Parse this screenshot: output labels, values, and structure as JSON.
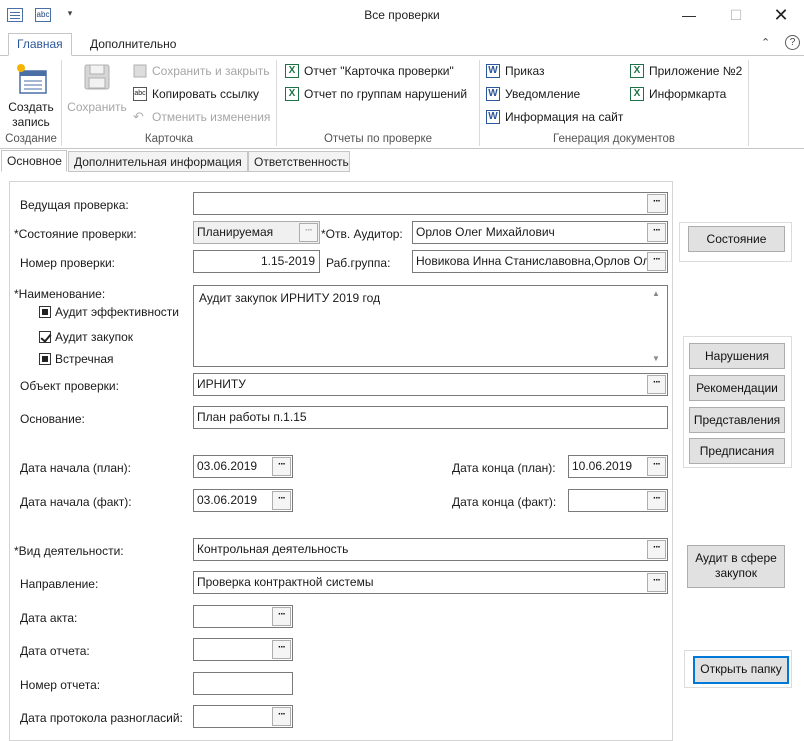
{
  "window": {
    "title": "Все проверки",
    "minimize": "—",
    "maximize": "☐",
    "close": "✕",
    "quick_abc": "abc",
    "quick_menu": "▾"
  },
  "ribbon_tabs": {
    "main": "Главная",
    "extra": "Дополнительно",
    "collapse": "⌃",
    "help": "?"
  },
  "ribbon": {
    "create": {
      "line1": "Создать",
      "line2": "запись",
      "group": "Создание"
    },
    "card": {
      "save": "Сохранить",
      "save_close": "Сохранить и закрыть",
      "copy_link": "Копировать ссылку",
      "undo": "Отменить изменения",
      "group": "Карточка"
    },
    "reports": {
      "card_report": "Отчет \"Карточка проверки\"",
      "violation_report": "Отчет по группам нарушений",
      "group": "Отчеты по проверке"
    },
    "docs": {
      "order": "Приказ",
      "notice": "Уведомление",
      "site_info": "Информация на сайт",
      "appendix2": "Приложение №2",
      "infocard": "Информкарта",
      "group": "Генерация документов"
    },
    "icon_letters": {
      "excel": "X",
      "word": "W",
      "abc": "abc"
    }
  },
  "content_tabs": {
    "main": "Основное",
    "additional": "Дополнительная информация",
    "responsibility": "Ответственность"
  },
  "form": {
    "lead_check": {
      "label": "Ведущая проверка:",
      "value": ""
    },
    "state": {
      "label": "*Состояние проверки:",
      "value": "Планируемая"
    },
    "auditor": {
      "label": "*Отв. Аудитор:",
      "value": "Орлов Олег Михайлович"
    },
    "number": {
      "label": "Номер проверки:",
      "value": "1.15-2019"
    },
    "workgroup": {
      "label": "Раб.группа:",
      "value": "Новикова Инна Станиславовна,Орлов Ол"
    },
    "name": {
      "label": "*Наименование:",
      "value": "Аудит закупок ИРНИТУ 2019 год"
    },
    "checks": [
      {
        "label": "Аудит эффективности",
        "state": "indeterminate"
      },
      {
        "label": "Аудит закупок",
        "state": "checked"
      },
      {
        "label": "Встречная",
        "state": "indeterminate"
      }
    ],
    "object": {
      "label": "Объект проверки:",
      "value": "ИРНИТУ"
    },
    "basis": {
      "label": "Основание:",
      "value": "План работы п.1.15"
    },
    "start_plan": {
      "label": "Дата начала (план):",
      "value": "03.06.2019"
    },
    "end_plan": {
      "label": "Дата конца (план):",
      "value": "10.06.2019"
    },
    "start_fact": {
      "label": "Дата начала (факт):",
      "value": "03.06.2019"
    },
    "end_fact": {
      "label": "Дата конца (факт):",
      "value": ""
    },
    "activity": {
      "label": "*Вид деятельности:",
      "value": "Контрольная деятельность"
    },
    "direction": {
      "label": "Направление:",
      "value": "Проверка контрактной системы"
    },
    "act_date": {
      "label": "Дата акта:",
      "value": ""
    },
    "report_date": {
      "label": "Дата отчета:",
      "value": ""
    },
    "report_number": {
      "label": "Номер отчета:",
      "value": ""
    },
    "protocol_date": {
      "label": "Дата протокола разногласий:",
      "value": ""
    },
    "dots": "···"
  },
  "side": {
    "state_btn": "Состояние",
    "violations": "Нарушения",
    "recommendations": "Рекомендации",
    "representations": "Представления",
    "prescriptions": "Предписания",
    "procurement_line1": "Аудит в сфере",
    "procurement_line2": "закупок",
    "open_folder": "Открыть папку"
  }
}
